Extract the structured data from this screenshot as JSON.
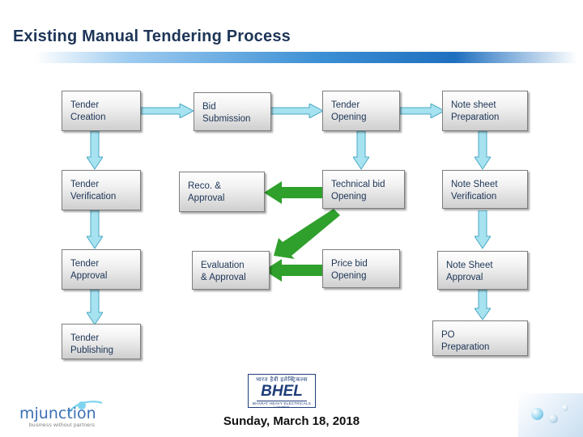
{
  "page": {
    "title": "Existing Manual Tendering Process",
    "date": "Sunday, March 18, 2018"
  },
  "diagram": {
    "type": "flowchart",
    "boxes": [
      {
        "id": "tender-creation",
        "label": "Tender\nCreation",
        "line1": "Tender",
        "line2": "Creation",
        "col": 1,
        "row": 1
      },
      {
        "id": "bid-submission",
        "label": "Bid\nSubmission",
        "line1": "Bid",
        "line2": "Submission",
        "col": 2,
        "row": 1
      },
      {
        "id": "tender-opening",
        "label": "Tender\nOpening",
        "line1": "Tender",
        "line2": "Opening",
        "col": 3,
        "row": 1
      },
      {
        "id": "note-sheet-preparation",
        "label": "Note sheet\nPreparation",
        "line1": "Note sheet",
        "line2": "Preparation",
        "col": 4,
        "row": 1
      },
      {
        "id": "tender-verification",
        "label": "Tender\nVerification",
        "line1": "Tender",
        "line2": "Verification",
        "col": 1,
        "row": 2
      },
      {
        "id": "reco-approval",
        "label": "Reco. &\nApproval",
        "line1": "Reco. &",
        "line2": "Approval",
        "col": 2,
        "row": 2
      },
      {
        "id": "technical-bid-opening",
        "label": "Technical bid\nOpening",
        "line1": "Technical bid",
        "line2": "Opening",
        "col": 3,
        "row": 2
      },
      {
        "id": "note-sheet-verification",
        "label": "Note Sheet\nVerification",
        "line1": "Note Sheet",
        "line2": "Verification",
        "col": 4,
        "row": 2
      },
      {
        "id": "tender-approval",
        "label": "Tender\nApproval",
        "line1": "Tender",
        "line2": "Approval",
        "col": 1,
        "row": 3
      },
      {
        "id": "evaluation-approval",
        "label": "Evaluation\n& Approval",
        "line1": "Evaluation",
        "line2": "& Approval",
        "col": 2,
        "row": 3
      },
      {
        "id": "price-bid-opening",
        "label": "Price bid\nOpening",
        "line1": "Price bid",
        "line2": "Opening",
        "col": 3,
        "row": 3
      },
      {
        "id": "note-sheet-approval",
        "label": "Note Sheet\nApproval",
        "line1": "Note Sheet",
        "line2": "Approval",
        "col": 4,
        "row": 3
      },
      {
        "id": "tender-publishing",
        "label": "Tender\nPublishing",
        "line1": "Tender",
        "line2": "Publishing",
        "col": 1,
        "row": 4
      },
      {
        "id": "po-preparation",
        "label": "PO\nPreparation",
        "line1": "PO",
        "line2": "Preparation",
        "col": 4,
        "row": 4
      }
    ],
    "arrow_colors": {
      "blue": "#9fe0ef",
      "blue_border": "#4aa8c4",
      "green": "#33a02c",
      "green_light": "#4cb944"
    }
  },
  "logos": {
    "mjunction": {
      "name": "mjunction",
      "tagline": "business without partners"
    },
    "bhel": {
      "hindi": "भारत हैवी इलेक्ट्रिकल्स",
      "name": "BHEL",
      "sub": "BHARAT HEAVY ELECTRICALS LIMITED"
    }
  }
}
